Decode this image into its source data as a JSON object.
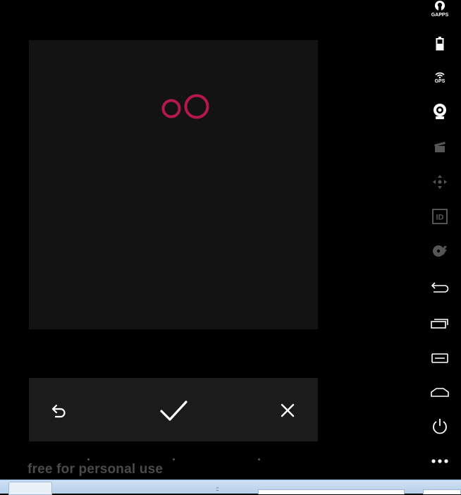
{
  "editor": {
    "logo_icon": "two-rings-logo-icon",
    "accent_color": "#c2185b"
  },
  "actions": {
    "undo_icon": "undo-icon",
    "confirm_icon": "checkmark-icon",
    "cancel_icon": "close-icon"
  },
  "watermark": {
    "text": "free for personal use"
  },
  "sidebar": {
    "items": [
      {
        "name": "gapps",
        "label": "GAPPS",
        "icon": "gapps-icon"
      },
      {
        "name": "battery",
        "label": "",
        "icon": "battery-icon"
      },
      {
        "name": "gps",
        "label": "GPS",
        "icon": "gps-icon"
      },
      {
        "name": "camera",
        "label": "",
        "icon": "webcam-icon"
      },
      {
        "name": "media",
        "label": "",
        "icon": "clapperboard-icon"
      },
      {
        "name": "dpad",
        "label": "",
        "icon": "dpad-icon"
      },
      {
        "name": "id",
        "label": "ID",
        "icon": "id-icon"
      },
      {
        "name": "disk",
        "label": "",
        "icon": "disk-icon"
      },
      {
        "name": "back",
        "label": "",
        "icon": "back-icon"
      },
      {
        "name": "recent",
        "label": "",
        "icon": "recent-apps-icon"
      },
      {
        "name": "menu",
        "label": "",
        "icon": "menu-icon"
      },
      {
        "name": "home",
        "label": "",
        "icon": "home-icon"
      },
      {
        "name": "power",
        "label": "",
        "icon": "power-icon"
      },
      {
        "name": "more",
        "label": "",
        "icon": "more-icon"
      }
    ]
  }
}
